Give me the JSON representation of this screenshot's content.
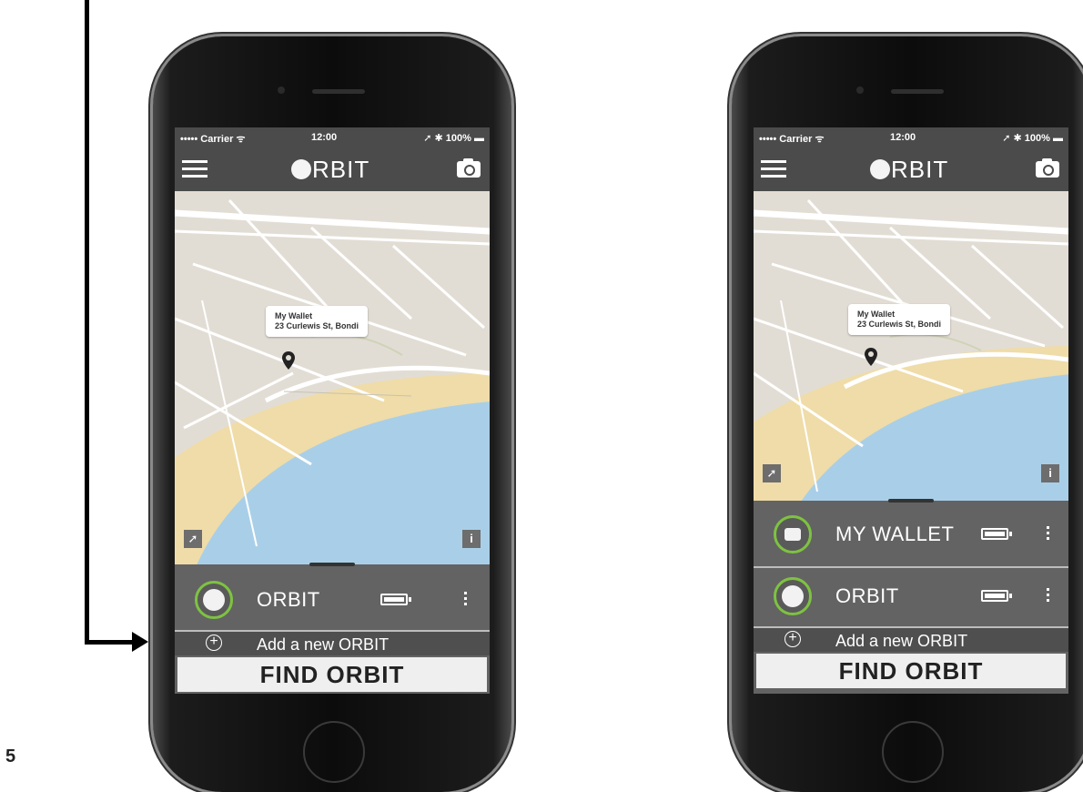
{
  "figure": {
    "page_number": "5"
  },
  "phones": [
    {
      "status": {
        "carrier": "••••• Carrier ᯤ",
        "time": "12:00",
        "right": "➚ ✱ 100% ▬"
      },
      "app": {
        "logo_text": "RBIT"
      },
      "map": {
        "callout_title": "My Wallet",
        "callout_address": "23 Curlewis St, Bondi",
        "info_label": "i"
      },
      "devices": [
        {
          "name": "ORBIT",
          "icon": "orbit-tag-icon"
        }
      ],
      "add_label": "Add a new ORBIT",
      "find_label": "FIND ORBIT"
    },
    {
      "status": {
        "carrier": "••••• Carrier ᯤ",
        "time": "12:00",
        "right": "➚ ✱ 100% ▬"
      },
      "app": {
        "logo_text": "RBIT"
      },
      "map": {
        "callout_title": "My Wallet",
        "callout_address": "23 Curlewis St, Bondi",
        "info_label": "i"
      },
      "devices": [
        {
          "name": "MY WALLET",
          "icon": "wallet-icon"
        },
        {
          "name": "ORBIT",
          "icon": "orbit-tag-icon"
        }
      ],
      "add_label": "Add a new ORBIT",
      "find_label": "FIND ORBIT"
    }
  ],
  "colors": {
    "accent_ring": "#7ec242",
    "app_bg": "#4b4b4b",
    "panel_bg": "#636363",
    "water": "#a9cfe8",
    "sand": "#efdca8"
  }
}
